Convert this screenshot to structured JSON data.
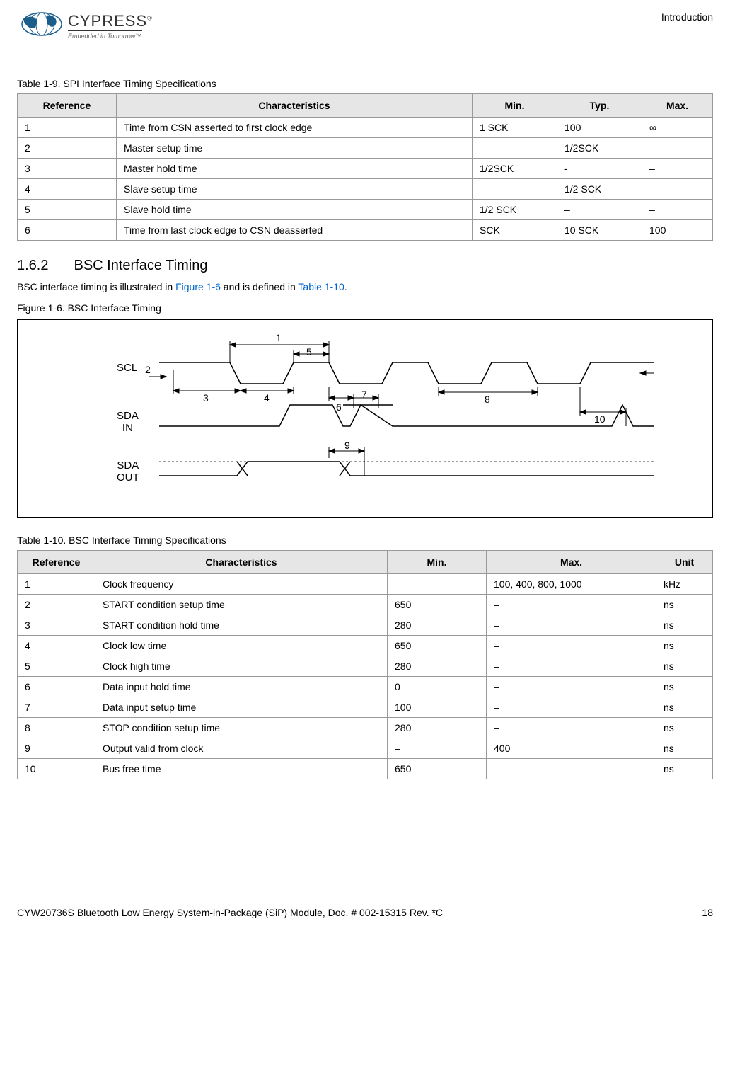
{
  "header": {
    "logo_text": "CYPRESS",
    "logo_tagline": "Embedded in Tomorrow™",
    "section_label": "Introduction"
  },
  "table1": {
    "title": "Table 1-9.  SPI Interface Timing Specifications",
    "headers": {
      "ref": "Reference",
      "char": "Characteristics",
      "min": "Min.",
      "typ": "Typ.",
      "max": "Max."
    },
    "rows": [
      {
        "ref": "1",
        "char": "Time from CSN asserted to first clock edge",
        "min": "1 SCK",
        "typ": "100",
        "max": "∞"
      },
      {
        "ref": "2",
        "char": "Master setup time",
        "min": "–",
        "typ": "1/2SCK",
        "max": "–"
      },
      {
        "ref": "3",
        "char": "Master hold time",
        "min": "1/2SCK",
        "typ": "-",
        "max": "–"
      },
      {
        "ref": "4",
        "char": "Slave setup time",
        "min": "–",
        "typ": "1/2 SCK",
        "max": "–"
      },
      {
        "ref": "5",
        "char": "Slave hold time",
        "min": "1/2 SCK",
        "typ": "–",
        "max": "–"
      },
      {
        "ref": "6",
        "char": "Time from last clock edge to CSN deasserted",
        "min": "SCK",
        "typ": "10 SCK",
        "max": "100"
      }
    ]
  },
  "section": {
    "number": "1.6.2",
    "title": "BSC Interface Timing",
    "body_pre": "BSC interface timing is illustrated in ",
    "link1": "Figure 1-6",
    "body_mid": " and is defined in ",
    "link2": "Table 1-10",
    "body_post": "."
  },
  "figure": {
    "title": "Figure 1-6.  BSC Interface Timing",
    "labels": {
      "scl": "SCL",
      "sda_in": "SDA",
      "sda_in2": "IN",
      "sda_out": "SDA",
      "sda_out2": "OUT"
    },
    "markers": [
      "1",
      "2",
      "3",
      "4",
      "5",
      "6",
      "7",
      "8",
      "9",
      "10"
    ]
  },
  "table2": {
    "title": "Table 1-10.  BSC Interface Timing Specifications",
    "headers": {
      "ref": "Reference",
      "char": "Characteristics",
      "min": "Min.",
      "max": "Max.",
      "unit": "Unit"
    },
    "rows": [
      {
        "ref": "1",
        "char": "Clock frequency",
        "min": "–",
        "max": "100, 400, 800, 1000",
        "unit": "kHz"
      },
      {
        "ref": "2",
        "char": "START condition setup time",
        "min": "650",
        "max": "–",
        "unit": "ns"
      },
      {
        "ref": "3",
        "char": "START condition hold time",
        "min": "280",
        "max": "–",
        "unit": "ns"
      },
      {
        "ref": "4",
        "char": "Clock low time",
        "min": "650",
        "max": "–",
        "unit": "ns"
      },
      {
        "ref": "5",
        "char": "Clock high time",
        "min": "280",
        "max": "–",
        "unit": "ns"
      },
      {
        "ref": "6",
        "char": "Data input hold time",
        "min": "0",
        "max": "–",
        "unit": "ns"
      },
      {
        "ref": "7",
        "char": "Data input setup time",
        "min": "100",
        "max": "–",
        "unit": "ns"
      },
      {
        "ref": "8",
        "char": "STOP condition setup time",
        "min": "280",
        "max": "–",
        "unit": "ns"
      },
      {
        "ref": "9",
        "char": "Output valid from clock",
        "min": "–",
        "max": "400",
        "unit": "ns"
      },
      {
        "ref": "10",
        "char": "Bus free time",
        "min": "650",
        "max": "–",
        "unit": "ns"
      }
    ]
  },
  "footer": {
    "left": "CYW20736S Bluetooth Low Energy System-in-Package (SiP) Module, Doc. # 002-15315 Rev. *C",
    "right": "18"
  }
}
